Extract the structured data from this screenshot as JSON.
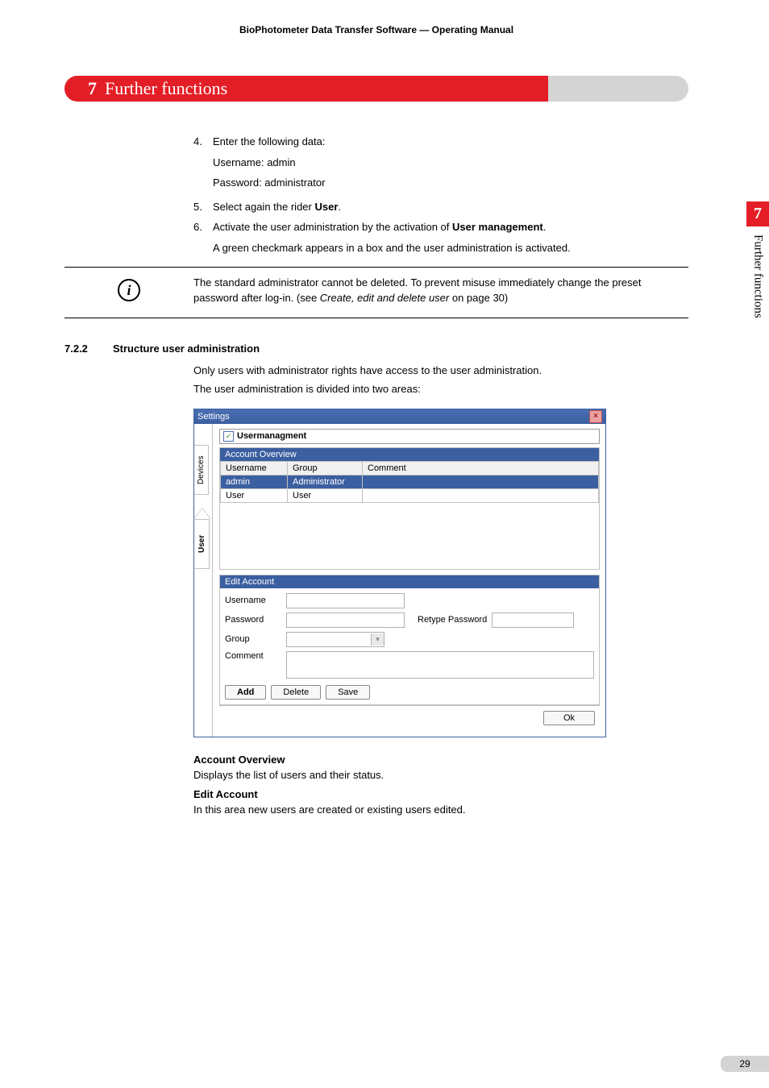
{
  "header": "BioPhotometer Data Transfer Software  —  Operating Manual",
  "chapter": {
    "number": "7",
    "title": "Further functions"
  },
  "steps": {
    "s4": {
      "num": "4.",
      "text": "Enter the following data:",
      "sub1": "Username: admin",
      "sub2": "Password: administrator"
    },
    "s5": {
      "num": "5.",
      "text_a": "Select again the rider ",
      "bold": "User",
      "text_b": "."
    },
    "s6": {
      "num": "6.",
      "text_a": "Activate the user administration by the activation of  ",
      "bold": "User management",
      "text_b": ".",
      "sub": "A green checkmark appears in a box and the user administration is activated."
    }
  },
  "info_note": {
    "line": "The standard administrator cannot be deleted. To prevent misuse immediately change the preset password after log-in. (see ",
    "ref_italic": "Create, edit and delete user",
    "ref_tail": " on page 30)"
  },
  "section": {
    "number": "7.2.2",
    "title": "Structure user administration"
  },
  "section_body": {
    "p1": "Only users with administrator rights have access to the user administration.",
    "p2": "The user administration is divided into two areas:"
  },
  "screenshot": {
    "title": "Settings",
    "checkbox_label": "Usermanagment",
    "tab_devices": "Devices",
    "tab_user": "User",
    "account_overview": "Account Overview",
    "cols": {
      "username": "Username",
      "group": "Group",
      "comment": "Comment"
    },
    "rows": [
      {
        "username": "admin",
        "group": "Administrator",
        "comment": "",
        "selected": true
      },
      {
        "username": "User",
        "group": "User",
        "comment": "",
        "selected": false
      }
    ],
    "edit_account": "Edit Account",
    "labels": {
      "username": "Username",
      "password": "Password",
      "retype": "Retype Password",
      "group": "Group",
      "comment": "Comment"
    },
    "buttons": {
      "add": "Add",
      "delete": "Delete",
      "save": "Save",
      "ok": "Ok"
    }
  },
  "descriptions": {
    "h1": "Account Overview",
    "t1": "Displays the list of users and their status.",
    "h2": "Edit Account",
    "t2": "In this area new users are created or existing users edited."
  },
  "thumb": {
    "num": "7",
    "label": "Further functions"
  },
  "page_number": "29"
}
